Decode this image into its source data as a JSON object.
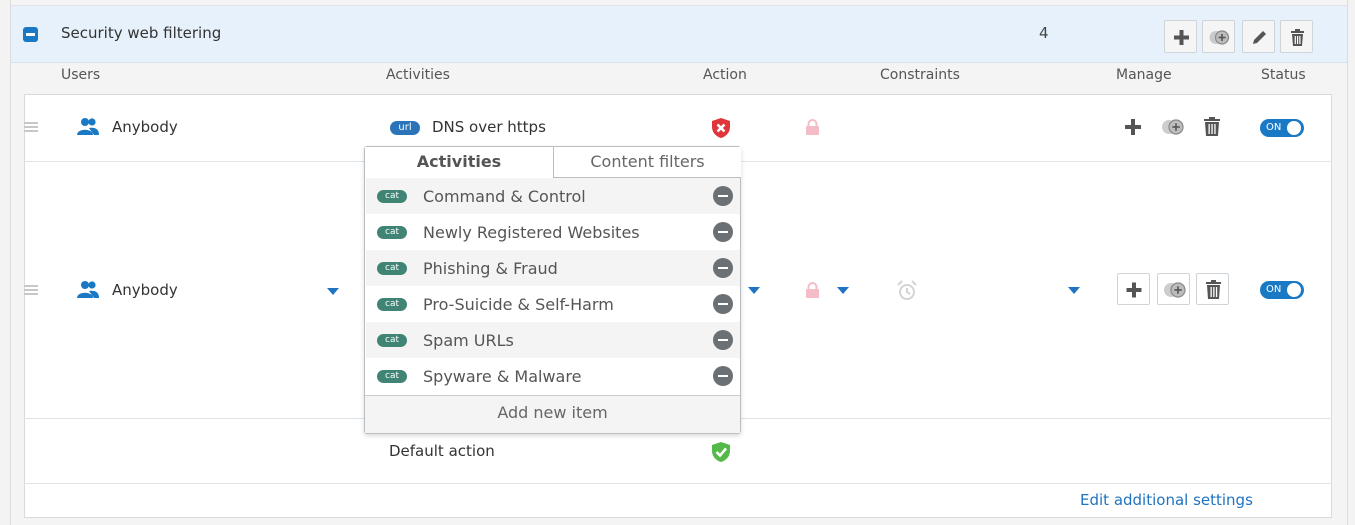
{
  "group": {
    "title": "Security web filtering",
    "count": "4"
  },
  "columns": {
    "users": "Users",
    "activities": "Activities",
    "action": "Action",
    "constraints": "Constraints",
    "manage": "Manage",
    "status": "Status"
  },
  "rules": [
    {
      "user": "Anybody",
      "activity": "DNS over https",
      "activity_badge": "url",
      "status": "ON"
    },
    {
      "user": "Anybody",
      "status": "ON"
    }
  ],
  "default_action": "Default action",
  "edit_link": "Edit additional settings",
  "popup": {
    "tabs": [
      "Activities",
      "Content filters"
    ],
    "items": [
      {
        "badge": "cat",
        "label": "Command & Control"
      },
      {
        "badge": "cat",
        "label": "Newly Registered Websites"
      },
      {
        "badge": "cat",
        "label": "Phishing & Fraud"
      },
      {
        "badge": "cat",
        "label": "Pro-Suicide & Self-Harm"
      },
      {
        "badge": "cat",
        "label": "Spam URLs"
      },
      {
        "badge": "cat",
        "label": "Spyware & Malware"
      }
    ],
    "add_item": "Add new item"
  },
  "colors": {
    "accent": "#1a79c5",
    "header_bg": "#e6f1fb",
    "cat_badge": "#3f8474",
    "block_red": "#e0363b",
    "allow_green": "#54b949"
  }
}
